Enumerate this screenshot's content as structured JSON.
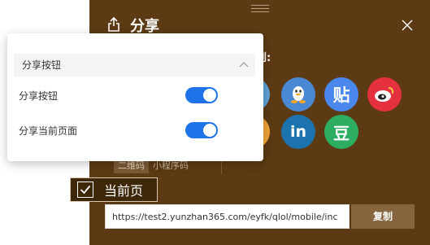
{
  "share_panel": {
    "title": "分享",
    "share_to_label": "到:",
    "tabs": [
      "二维码",
      "小程序码"
    ],
    "url_value": "https://test2.yunzhan365.com/eyfk/qlol/mobile/inc",
    "copy_label": "复制",
    "social_icons": [
      "qzone-icon",
      "qq-icon",
      "tieba-icon",
      "weibo-icon",
      "orange-icon",
      "linkedin-icon",
      "douban-icon"
    ],
    "tieba_glyph": "贴",
    "linkedin_glyph": "in",
    "douban_glyph": "豆"
  },
  "popover": {
    "header_label": "分享按钮",
    "rows": [
      {
        "label": "分享按钮",
        "enabled": true
      },
      {
        "label": "分享当前页面",
        "enabled": true
      }
    ]
  },
  "current_page_chip": {
    "label": "当前页",
    "checked": true
  },
  "colors": {
    "panel_bg": "#5c3a13",
    "toggle_on": "#1e73e8",
    "copy_bg": "#86643e"
  }
}
